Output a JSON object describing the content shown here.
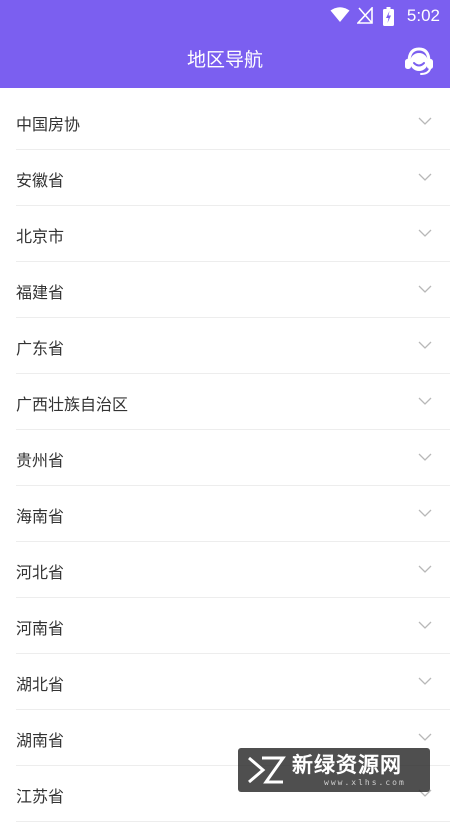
{
  "status_bar": {
    "time": "5:02",
    "icons": [
      "wifi-icon",
      "no-signal-icon",
      "battery-charging-icon"
    ]
  },
  "header": {
    "title": "地区导航",
    "service_icon": "customer-service-icon",
    "background_color": "#7b5ff0"
  },
  "regions": [
    {
      "label": "中国房协"
    },
    {
      "label": "安徽省"
    },
    {
      "label": "北京市"
    },
    {
      "label": "福建省"
    },
    {
      "label": "广东省"
    },
    {
      "label": "广西壮族自治区"
    },
    {
      "label": "贵州省"
    },
    {
      "label": "海南省"
    },
    {
      "label": "河北省"
    },
    {
      "label": "河南省"
    },
    {
      "label": "湖北省"
    },
    {
      "label": "湖南省"
    },
    {
      "label": "江苏省"
    }
  ],
  "watermark": {
    "text": "新绿资源网",
    "url": "www.xlhs.com"
  }
}
